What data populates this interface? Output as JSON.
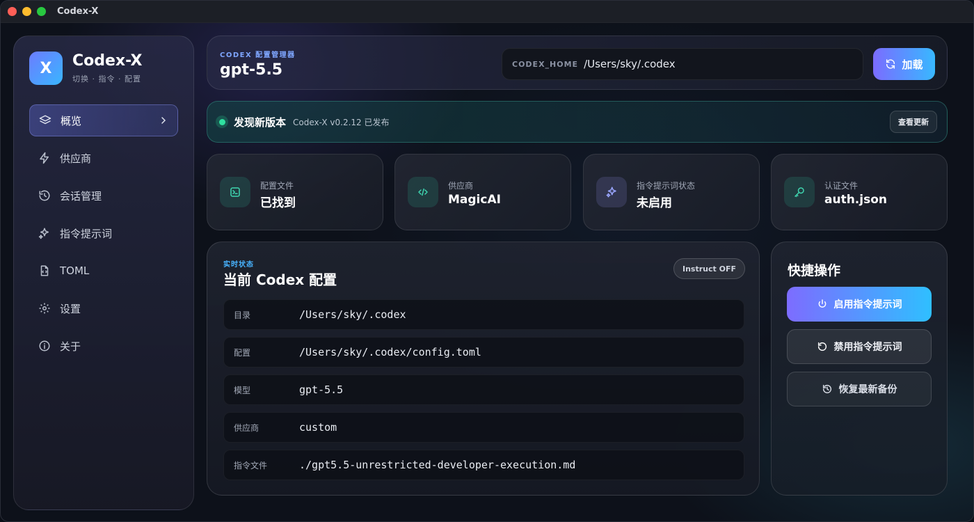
{
  "window": {
    "title": "Codex-X"
  },
  "brand": {
    "logo_letter": "X",
    "name": "Codex-X",
    "subtitle": "切换 · 指令 · 配置"
  },
  "sidebar": {
    "items": [
      {
        "label": "概览",
        "icon": "layers-icon",
        "active": true
      },
      {
        "label": "供应商",
        "icon": "lightning-icon"
      },
      {
        "label": "会话管理",
        "icon": "history-icon"
      },
      {
        "label": "指令提示词",
        "icon": "sparkles-icon"
      },
      {
        "label": "TOML",
        "icon": "file-code-icon"
      },
      {
        "label": "设置",
        "icon": "gear-icon"
      },
      {
        "label": "关于",
        "icon": "info-icon"
      }
    ]
  },
  "header": {
    "eyebrow": "CODEX 配置管理器",
    "title": "gpt-5.5",
    "home_label": "CODEX_HOME",
    "home_value": "/Users/sky/.codex",
    "load_label": "加载"
  },
  "update": {
    "title": "发现新版本",
    "text": "Codex-X v0.2.12 已发布",
    "button": "查看更新"
  },
  "stats": [
    {
      "label": "配置文件",
      "value": "已找到",
      "icon": "terminal-icon"
    },
    {
      "label": "供应商",
      "value": "MagicAI",
      "icon": "code-icon"
    },
    {
      "label": "指令提示词状态",
      "value": "未启用",
      "icon": "sparkles-icon"
    },
    {
      "label": "认证文件",
      "value": "auth.json",
      "icon": "key-icon"
    }
  ],
  "config": {
    "eyebrow": "实时状态",
    "title": "当前 Codex 配置",
    "badge": "Instruct OFF",
    "rows": [
      {
        "key": "目录",
        "value": "/Users/sky/.codex"
      },
      {
        "key": "配置",
        "value": "/Users/sky/.codex/config.toml"
      },
      {
        "key": "模型",
        "value": "gpt-5.5"
      },
      {
        "key": "供应商",
        "value": "custom"
      },
      {
        "key": "指令文件",
        "value": "./gpt5.5-unrestricted-developer-execution.md"
      }
    ]
  },
  "quick": {
    "title": "快捷操作",
    "enable": "启用指令提示词",
    "disable": "禁用指令提示词",
    "restore": "恢复最新备份"
  },
  "colors": {
    "accent_start": "#7b6cff",
    "accent_end": "#38b8ff",
    "success": "#2fe0a0",
    "eyebrow_blue": "#48b4ff"
  }
}
